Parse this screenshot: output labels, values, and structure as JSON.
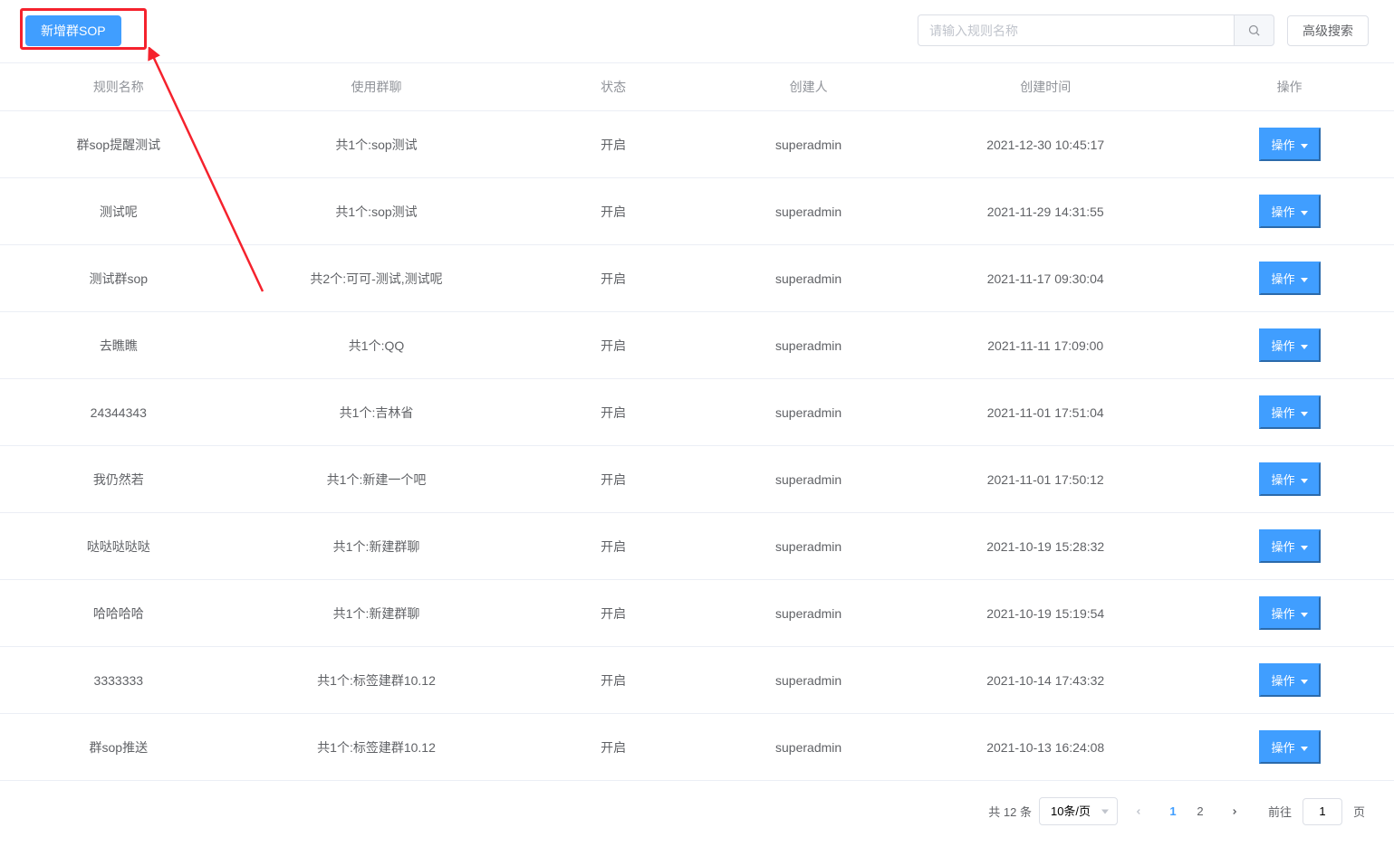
{
  "toolbar": {
    "add_button_label": "新增群SOP",
    "search_placeholder": "请输入规则名称",
    "advanced_search_label": "高级搜索"
  },
  "columns": {
    "name": "规则名称",
    "group": "使用群聊",
    "status": "状态",
    "creator": "创建人",
    "time": "创建时间",
    "action": "操作"
  },
  "action_label": "操作",
  "rows": [
    {
      "name": "群sop提醒测试",
      "group": "共1个:sop测试",
      "status": "开启",
      "creator": "superadmin",
      "time": "2021-12-30 10:45:17"
    },
    {
      "name": "测试呢",
      "group": "共1个:sop测试",
      "status": "开启",
      "creator": "superadmin",
      "time": "2021-11-29 14:31:55"
    },
    {
      "name": "测试群sop",
      "group": "共2个:可可-测试,测试呢",
      "status": "开启",
      "creator": "superadmin",
      "time": "2021-11-17 09:30:04"
    },
    {
      "name": "去瞧瞧",
      "group": "共1个:QQ",
      "status": "开启",
      "creator": "superadmin",
      "time": "2021-11-11 17:09:00"
    },
    {
      "name": "24344343",
      "group": "共1个:吉林省",
      "status": "开启",
      "creator": "superadmin",
      "time": "2021-11-01 17:51:04"
    },
    {
      "name": "我仍然若",
      "group": "共1个:新建一个吧",
      "status": "开启",
      "creator": "superadmin",
      "time": "2021-11-01 17:50:12"
    },
    {
      "name": "哒哒哒哒哒",
      "group": "共1个:新建群聊",
      "status": "开启",
      "creator": "superadmin",
      "time": "2021-10-19 15:28:32"
    },
    {
      "name": "哈哈哈哈",
      "group": "共1个:新建群聊",
      "status": "开启",
      "creator": "superadmin",
      "time": "2021-10-19 15:19:54"
    },
    {
      "name": "3333333",
      "group": "共1个:标签建群10.12",
      "status": "开启",
      "creator": "superadmin",
      "time": "2021-10-14 17:43:32"
    },
    {
      "name": "群sop推送",
      "group": "共1个:标签建群10.12",
      "status": "开启",
      "creator": "superadmin",
      "time": "2021-10-13 16:24:08"
    }
  ],
  "pagination": {
    "total_text": "共 12 条",
    "page_size_label": "10条/页",
    "pages": [
      "1",
      "2"
    ],
    "current_page": "1",
    "goto_prefix": "前往",
    "goto_value": "1",
    "goto_suffix": "页"
  }
}
